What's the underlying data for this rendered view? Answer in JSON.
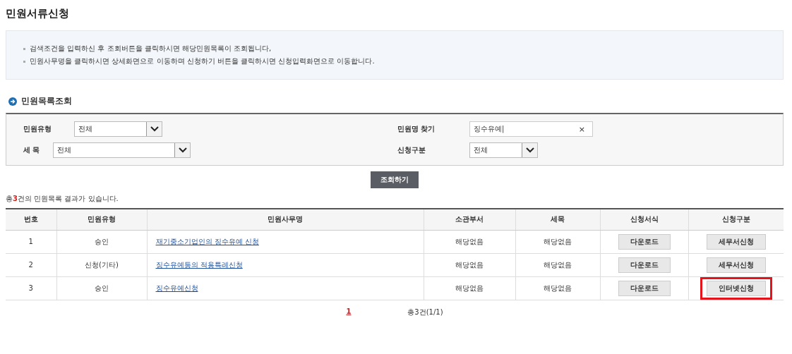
{
  "title": "민원서류신청",
  "notice": [
    "검색조건을 입력하신 후 조회버튼을 클릭하시면 해당민원목록이 조회됩니다,",
    "민원사무명을 클릭하시면 상세화면으로 이동하며  신청하기 버튼을 클릭하시면 신청입력화면으로 이동합니다."
  ],
  "section_title": "민원목록조회",
  "search": {
    "type_label": "민원유형",
    "type_value": "전체",
    "name_label": "민원명 찾기",
    "name_value": "징수유예|",
    "clear": "×",
    "tax_label": "세 목",
    "tax_value": "전체",
    "apply_label": "신청구분",
    "apply_value": "전체",
    "submit": "조회하기"
  },
  "result": {
    "prefix": "총",
    "count": "3",
    "suffix": "건의 민원목록 결과가 있습니다."
  },
  "table": {
    "columns": [
      "번호",
      "민원유형",
      "민원사무명",
      "소관부서",
      "세목",
      "신청서식",
      "신청구분"
    ],
    "rows": [
      {
        "no": "1",
        "type": "승인",
        "name": "재기중소기업인의 징수유예 신청",
        "dept": "해당없음",
        "tax": "해당없음",
        "form": "다운로드",
        "apply": "세무서신청",
        "highlighted": false
      },
      {
        "no": "2",
        "type": "신청(기타)",
        "name": "징수유예등의 적용특례신청",
        "dept": "해당없음",
        "tax": "해당없음",
        "form": "다운로드",
        "apply": "세무서신청",
        "highlighted": false
      },
      {
        "no": "3",
        "type": "승인",
        "name": "징수유예신청",
        "dept": "해당없음",
        "tax": "해당없음",
        "form": "다운로드",
        "apply": "인터넷신청",
        "highlighted": true
      }
    ]
  },
  "pagination": {
    "pages": [
      {
        "label": "1",
        "selected": true
      }
    ],
    "summary": "총3건(1/1)"
  }
}
